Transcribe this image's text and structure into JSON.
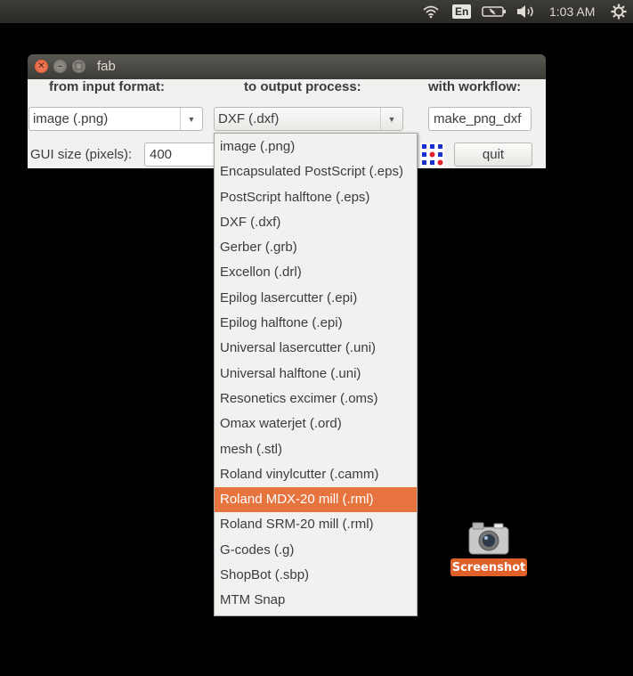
{
  "panel": {
    "language": "En",
    "time": "1:03 AM",
    "icons": [
      "wifi-icon",
      "battery-icon",
      "volume-icon",
      "gear-icon"
    ]
  },
  "window": {
    "title": "fab",
    "headers": {
      "input": "from input format:",
      "output": "to output process:",
      "workflow": "with workflow:"
    },
    "input_format": "image (.png)",
    "output_process": "DXF (.dxf)",
    "workflow": "make_png_dxf",
    "gui_size_label": "GUI size (pixels):",
    "gui_size_value": "400",
    "quit_label": "quit"
  },
  "dropdown": {
    "items": [
      "image (.png)",
      "Encapsulated PostScript (.eps)",
      "PostScript halftone (.eps)",
      "DXF (.dxf)",
      "Gerber (.grb)",
      "Excellon (.drl)",
      "Epilog lasercutter (.epi)",
      "Epilog halftone (.epi)",
      "Universal lasercutter (.uni)",
      "Universal halftone (.uni)",
      "Resonetics excimer (.oms)",
      "Omax waterjet (.ord)",
      "mesh (.stl)",
      "Roland vinylcutter (.camm)",
      "Roland MDX-20 mill (.rml)",
      "Roland SRM-20 mill (.rml)",
      "G-codes (.g)",
      "ShopBot (.sbp)",
      "MTM Snap"
    ],
    "highlighted": "Roland MDX-20 mill (.rml)"
  },
  "desktop": {
    "icon_label": "Screenshot",
    "icon_name": "camera-icon"
  },
  "colors": {
    "accent": "#e7743e",
    "panel_bg": "#3c3b37",
    "desktop_bg": "#000000"
  }
}
